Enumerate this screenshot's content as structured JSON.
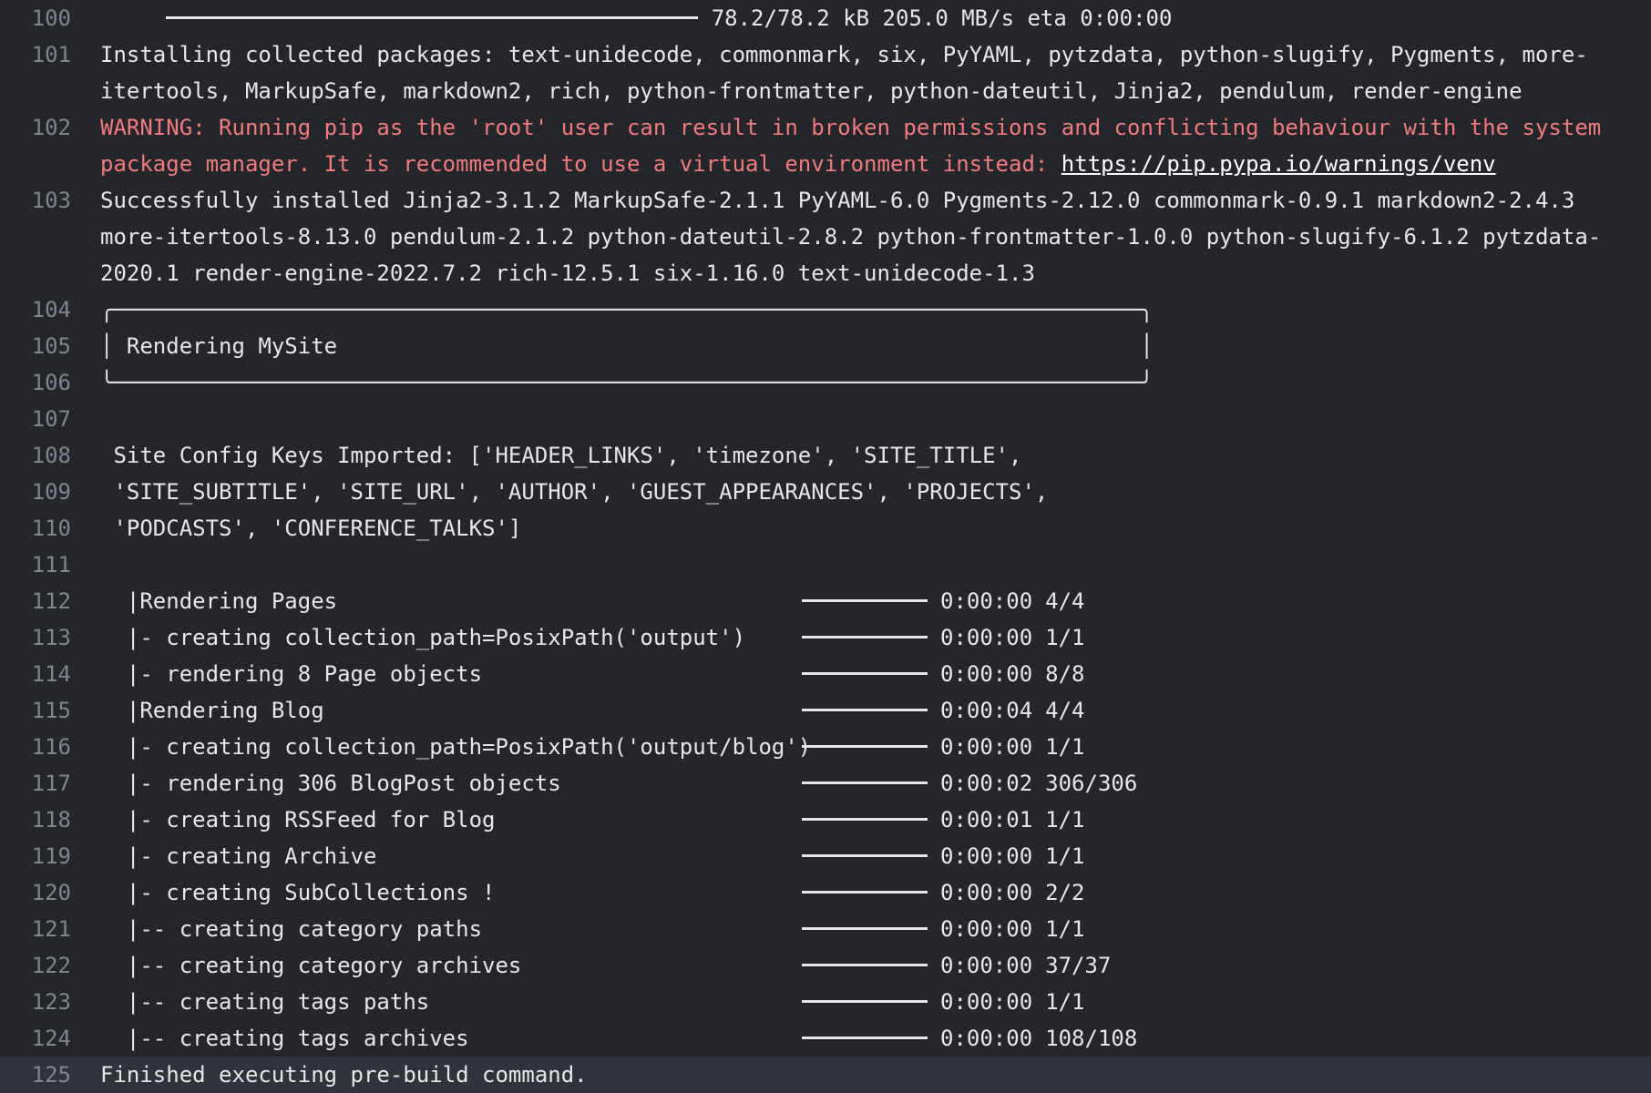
{
  "lines": [
    {
      "no": "100",
      "kind": "progress",
      "prefix": "     ",
      "text": " 78.2/78.2 kB 205.0 MB/s eta 0:00:00"
    },
    {
      "no": "101",
      "kind": "text",
      "text": "Installing collected packages: text-unidecode, commonmark, six, PyYAML, pytzdata, python-slugify, Pygments, more-"
    },
    {
      "no": "",
      "kind": "text",
      "text": "itertools, MarkupSafe, markdown2, rich, python-frontmatter, python-dateutil, Jinja2, pendulum, render-engine"
    },
    {
      "no": "102",
      "kind": "warn",
      "text": "WARNING: Running pip as the 'root' user can result in broken permissions and conflicting behaviour with the system"
    },
    {
      "no": "",
      "kind": "warn",
      "text": "package manager. It is recommended to use a virtual environment instead: ",
      "link": "https://pip.pypa.io/warnings/venv"
    },
    {
      "no": "103",
      "kind": "text",
      "text": "Successfully installed Jinja2-3.1.2 MarkupSafe-2.1.1 PyYAML-6.0 Pygments-2.12.0 commonmark-0.9.1 markdown2-2.4.3"
    },
    {
      "no": "",
      "kind": "text",
      "text": "more-itertools-8.13.0 pendulum-2.1.2 python-dateutil-2.8.2 python-frontmatter-1.0.0 python-slugify-6.1.2 pytzdata-"
    },
    {
      "no": "",
      "kind": "text",
      "text": "2020.1 render-engine-2022.7.2 rich-12.5.1 six-1.16.0 text-unidecode-1.3"
    },
    {
      "no": "104",
      "kind": "box",
      "text": "╭──────────────────────────────────────────────────────────────────────────────╮"
    },
    {
      "no": "105",
      "kind": "box",
      "text": "│ Rendering MySite                                                             │"
    },
    {
      "no": "106",
      "kind": "box",
      "text": "╰──────────────────────────────────────────────────────────────────────────────╯"
    },
    {
      "no": "107",
      "kind": "text",
      "text": ""
    },
    {
      "no": "108",
      "kind": "text",
      "text": " Site Config Keys Imported: ['HEADER_LINKS', 'timezone', 'SITE_TITLE',"
    },
    {
      "no": "109",
      "kind": "text",
      "text": " 'SITE_SUBTITLE', 'SITE_URL', 'AUTHOR', 'GUEST_APPEARANCES', 'PROJECTS',"
    },
    {
      "no": "110",
      "kind": "text",
      "text": " 'PODCASTS', 'CONFERENCE_TALKS']"
    },
    {
      "no": "111",
      "kind": "text",
      "text": ""
    },
    {
      "no": "112",
      "kind": "task",
      "label": "  |Rendering Pages",
      "time": "0:00:00",
      "count": "4/4"
    },
    {
      "no": "113",
      "kind": "task",
      "label": "  |- creating collection_path=PosixPath('output')",
      "time": "0:00:00",
      "count": "1/1"
    },
    {
      "no": "114",
      "kind": "task",
      "label": "  |- rendering 8 Page objects",
      "time": "0:00:00",
      "count": "8/8"
    },
    {
      "no": "115",
      "kind": "task",
      "label": "  |Rendering Blog",
      "time": "0:00:04",
      "count": "4/4"
    },
    {
      "no": "116",
      "kind": "task",
      "label": "  |- creating collection_path=PosixPath('output/blog')",
      "time": "0:00:00",
      "count": "1/1"
    },
    {
      "no": "117",
      "kind": "task",
      "label": "  |- rendering 306 BlogPost objects",
      "time": "0:00:02",
      "count": "306/306"
    },
    {
      "no": "118",
      "kind": "task",
      "label": "  |- creating RSSFeed for Blog",
      "time": "0:00:01",
      "count": "1/1"
    },
    {
      "no": "119",
      "kind": "task",
      "label": "  |- creating Archive",
      "time": "0:00:00",
      "count": "1/1"
    },
    {
      "no": "120",
      "kind": "task",
      "label": "  |- creating SubCollections !",
      "time": "0:00:00",
      "count": "2/2"
    },
    {
      "no": "121",
      "kind": "task",
      "label": "  |-- creating category paths",
      "time": "0:00:00",
      "count": "1/1"
    },
    {
      "no": "122",
      "kind": "task",
      "label": "  |-- creating category archives",
      "time": "0:00:00",
      "count": "37/37"
    },
    {
      "no": "123",
      "kind": "task",
      "label": "  |-- creating tags paths",
      "time": "0:00:00",
      "count": "1/1"
    },
    {
      "no": "124",
      "kind": "task",
      "label": "  |-- creating tags archives",
      "time": "0:00:00",
      "count": "108/108"
    },
    {
      "no": "125",
      "kind": "text",
      "highlight": true,
      "text": "Finished executing pre-build command."
    }
  ]
}
